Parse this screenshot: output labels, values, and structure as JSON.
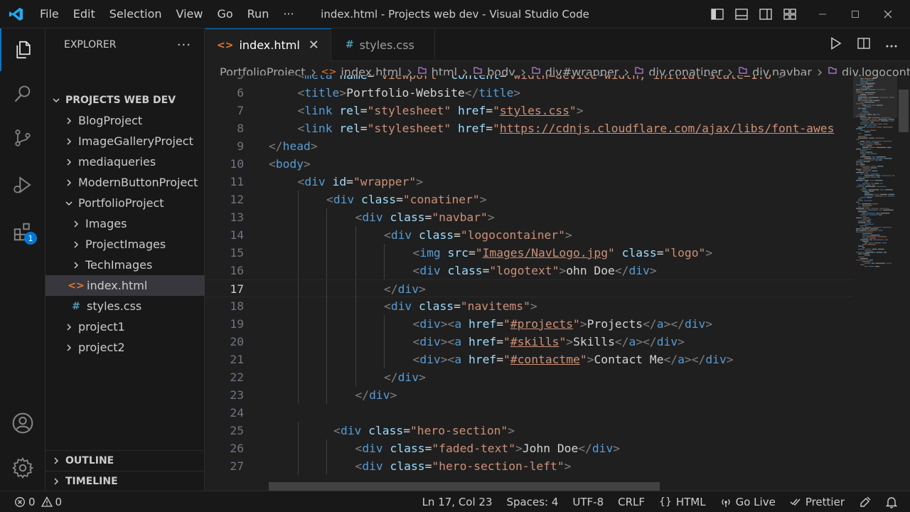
{
  "titlebar": {
    "menu": [
      "File",
      "Edit",
      "Selection",
      "View",
      "Go",
      "Run",
      "···"
    ],
    "title": "index.html - Projects web dev - Visual Studio Code"
  },
  "activitybar": {
    "extensions_badge": "1"
  },
  "sidebar": {
    "title": "EXPLORER",
    "more": "···",
    "root": "PROJECTS WEB DEV",
    "items": [
      {
        "label": "BlogProject",
        "kind": "folder",
        "expanded": false,
        "depth": 1
      },
      {
        "label": "ImageGalleryProject",
        "kind": "folder",
        "expanded": false,
        "depth": 1
      },
      {
        "label": "mediaqueries",
        "kind": "folder",
        "expanded": false,
        "depth": 1
      },
      {
        "label": "ModernButtonProject",
        "kind": "folder",
        "expanded": false,
        "depth": 1
      },
      {
        "label": "PortfolioProject",
        "kind": "folder",
        "expanded": true,
        "depth": 1
      },
      {
        "label": "Images",
        "kind": "folder",
        "expanded": false,
        "depth": 2
      },
      {
        "label": "ProjectImages",
        "kind": "folder",
        "expanded": false,
        "depth": 2
      },
      {
        "label": "TechImages",
        "kind": "folder",
        "expanded": false,
        "depth": 2
      },
      {
        "label": "index.html",
        "kind": "html",
        "depth": 2,
        "selected": true
      },
      {
        "label": "styles.css",
        "kind": "css",
        "depth": 2
      },
      {
        "label": "project1",
        "kind": "folder",
        "expanded": false,
        "depth": 1
      },
      {
        "label": "project2",
        "kind": "folder",
        "expanded": false,
        "depth": 1
      }
    ],
    "outline": "OUTLINE",
    "timeline": "TIMELINE"
  },
  "tabs": [
    {
      "label": "index.html",
      "icon": "<>",
      "active": true,
      "close": "✕"
    },
    {
      "label": "styles.css",
      "icon": "#",
      "active": false
    }
  ],
  "breadcrumb": [
    "PortfolioProject",
    "index.html",
    "html",
    "body",
    "div#wrapper",
    "div.conatiner",
    "div.navbar",
    "div.logocontai"
  ],
  "editor": {
    "current_line": 17,
    "lines": [
      {
        "n": 5,
        "indent": 1,
        "tokens": [
          [
            "t-br",
            "<"
          ],
          [
            "t-tag",
            "meta"
          ],
          [
            "t-text",
            " "
          ],
          [
            "t-attr",
            "name"
          ],
          [
            "t-text",
            "="
          ],
          [
            "t-str",
            "\"viewport\""
          ],
          [
            "t-text",
            " "
          ],
          [
            "t-attr",
            "content"
          ],
          [
            "t-text",
            "="
          ],
          [
            "t-str",
            "\"width=device-width, initial-scale=1.0\""
          ],
          [
            "t-br",
            ">"
          ]
        ]
      },
      {
        "n": 6,
        "indent": 1,
        "tokens": [
          [
            "t-br",
            "<"
          ],
          [
            "t-tag",
            "title"
          ],
          [
            "t-br",
            ">"
          ],
          [
            "t-text",
            "Portfolio-Website"
          ],
          [
            "t-br",
            "</"
          ],
          [
            "t-tag",
            "title"
          ],
          [
            "t-br",
            ">"
          ]
        ]
      },
      {
        "n": 7,
        "indent": 1,
        "tokens": [
          [
            "t-br",
            "<"
          ],
          [
            "t-tag",
            "link"
          ],
          [
            "t-text",
            " "
          ],
          [
            "t-attr",
            "rel"
          ],
          [
            "t-text",
            "="
          ],
          [
            "t-str",
            "\"stylesheet\""
          ],
          [
            "t-text",
            " "
          ],
          [
            "t-attr",
            "href"
          ],
          [
            "t-text",
            "="
          ],
          [
            "t-str",
            "\""
          ],
          [
            "t-link",
            "styles.css"
          ],
          [
            "t-str",
            "\""
          ],
          [
            "t-br",
            ">"
          ]
        ]
      },
      {
        "n": 8,
        "indent": 1,
        "tokens": [
          [
            "t-br",
            "<"
          ],
          [
            "t-tag",
            "link"
          ],
          [
            "t-text",
            " "
          ],
          [
            "t-attr",
            "rel"
          ],
          [
            "t-text",
            "="
          ],
          [
            "t-str",
            "\"stylesheet\""
          ],
          [
            "t-text",
            " "
          ],
          [
            "t-attr",
            "href"
          ],
          [
            "t-text",
            "="
          ],
          [
            "t-str",
            "\""
          ],
          [
            "t-link",
            "https://cdnjs.cloudflare.com/ajax/libs/font-awes"
          ]
        ]
      },
      {
        "n": 9,
        "indent": 0,
        "tokens": [
          [
            "t-br",
            "</"
          ],
          [
            "t-tag",
            "head"
          ],
          [
            "t-br",
            ">"
          ]
        ]
      },
      {
        "n": 10,
        "indent": 0,
        "tokens": [
          [
            "t-br",
            "<"
          ],
          [
            "t-tag",
            "body"
          ],
          [
            "t-br",
            ">"
          ]
        ]
      },
      {
        "n": 11,
        "indent": 1,
        "tokens": [
          [
            "t-br",
            "<"
          ],
          [
            "t-tag",
            "div"
          ],
          [
            "t-text",
            " "
          ],
          [
            "t-attr",
            "id"
          ],
          [
            "t-text",
            "="
          ],
          [
            "t-str",
            "\"wrapper\""
          ],
          [
            "t-br",
            ">"
          ]
        ]
      },
      {
        "n": 12,
        "indent": 2,
        "tokens": [
          [
            "t-br",
            "<"
          ],
          [
            "t-tag",
            "div"
          ],
          [
            "t-text",
            " "
          ],
          [
            "t-attr",
            "class"
          ],
          [
            "t-text",
            "="
          ],
          [
            "t-str",
            "\"conatiner\""
          ],
          [
            "t-br",
            ">"
          ]
        ]
      },
      {
        "n": 13,
        "indent": 3,
        "tokens": [
          [
            "t-br",
            "<"
          ],
          [
            "t-tag",
            "div"
          ],
          [
            "t-text",
            " "
          ],
          [
            "t-attr",
            "class"
          ],
          [
            "t-text",
            "="
          ],
          [
            "t-str",
            "\"navbar\""
          ],
          [
            "t-br",
            ">"
          ]
        ]
      },
      {
        "n": 14,
        "indent": 4,
        "tokens": [
          [
            "t-br",
            "<"
          ],
          [
            "t-tag",
            "div"
          ],
          [
            "t-text",
            " "
          ],
          [
            "t-attr",
            "class"
          ],
          [
            "t-text",
            "="
          ],
          [
            "t-str",
            "\"logocontainer\""
          ],
          [
            "t-br",
            ">"
          ]
        ]
      },
      {
        "n": 15,
        "indent": 5,
        "tokens": [
          [
            "t-br",
            "<"
          ],
          [
            "t-tag",
            "img"
          ],
          [
            "t-text",
            " "
          ],
          [
            "t-attr",
            "src"
          ],
          [
            "t-text",
            "="
          ],
          [
            "t-str",
            "\""
          ],
          [
            "t-link",
            "Images/NavLogo.jpg"
          ],
          [
            "t-str",
            "\""
          ],
          [
            "t-text",
            " "
          ],
          [
            "t-attr",
            "class"
          ],
          [
            "t-text",
            "="
          ],
          [
            "t-str",
            "\"logo\""
          ],
          [
            "t-br",
            ">"
          ]
        ]
      },
      {
        "n": 16,
        "indent": 5,
        "tokens": [
          [
            "t-br",
            "<"
          ],
          [
            "t-tag",
            "div"
          ],
          [
            "t-text",
            " "
          ],
          [
            "t-attr",
            "class"
          ],
          [
            "t-text",
            "="
          ],
          [
            "t-str",
            "\"logotext\""
          ],
          [
            "t-br",
            ">"
          ],
          [
            "t-text",
            "ohn Doe"
          ],
          [
            "t-br",
            "</"
          ],
          [
            "t-tag",
            "div"
          ],
          [
            "t-br",
            ">"
          ]
        ]
      },
      {
        "n": 17,
        "indent": 4,
        "tokens": [
          [
            "t-br",
            "</"
          ],
          [
            "t-tag",
            "div"
          ],
          [
            "t-br",
            ">"
          ]
        ]
      },
      {
        "n": 18,
        "indent": 4,
        "tokens": [
          [
            "t-br",
            "<"
          ],
          [
            "t-tag",
            "div"
          ],
          [
            "t-text",
            " "
          ],
          [
            "t-attr",
            "class"
          ],
          [
            "t-text",
            "="
          ],
          [
            "t-str",
            "\"navitems\""
          ],
          [
            "t-br",
            ">"
          ]
        ]
      },
      {
        "n": 19,
        "indent": 5,
        "tokens": [
          [
            "t-br",
            "<"
          ],
          [
            "t-tag",
            "div"
          ],
          [
            "t-br",
            "><"
          ],
          [
            "t-tag",
            "a"
          ],
          [
            "t-text",
            " "
          ],
          [
            "t-attr",
            "href"
          ],
          [
            "t-text",
            "="
          ],
          [
            "t-str",
            "\""
          ],
          [
            "t-link",
            "#projects"
          ],
          [
            "t-str",
            "\""
          ],
          [
            "t-br",
            ">"
          ],
          [
            "t-text",
            "Projects"
          ],
          [
            "t-br",
            "</"
          ],
          [
            "t-tag",
            "a"
          ],
          [
            "t-br",
            "></"
          ],
          [
            "t-tag",
            "div"
          ],
          [
            "t-br",
            ">"
          ]
        ]
      },
      {
        "n": 20,
        "indent": 5,
        "tokens": [
          [
            "t-br",
            "<"
          ],
          [
            "t-tag",
            "div"
          ],
          [
            "t-br",
            "><"
          ],
          [
            "t-tag",
            "a"
          ],
          [
            "t-text",
            " "
          ],
          [
            "t-attr",
            "href"
          ],
          [
            "t-text",
            "="
          ],
          [
            "t-str",
            "\""
          ],
          [
            "t-link",
            "#skills"
          ],
          [
            "t-str",
            "\""
          ],
          [
            "t-br",
            ">"
          ],
          [
            "t-text",
            "Skills"
          ],
          [
            "t-br",
            "</"
          ],
          [
            "t-tag",
            "a"
          ],
          [
            "t-br",
            "></"
          ],
          [
            "t-tag",
            "div"
          ],
          [
            "t-br",
            ">"
          ]
        ]
      },
      {
        "n": 21,
        "indent": 5,
        "tokens": [
          [
            "t-br",
            "<"
          ],
          [
            "t-tag",
            "div"
          ],
          [
            "t-br",
            "><"
          ],
          [
            "t-tag",
            "a"
          ],
          [
            "t-text",
            " "
          ],
          [
            "t-attr",
            "href"
          ],
          [
            "t-text",
            "="
          ],
          [
            "t-str",
            "\""
          ],
          [
            "t-link",
            "#contactme"
          ],
          [
            "t-str",
            "\""
          ],
          [
            "t-br",
            ">"
          ],
          [
            "t-text",
            "Contact Me"
          ],
          [
            "t-br",
            "</"
          ],
          [
            "t-tag",
            "a"
          ],
          [
            "t-br",
            "></"
          ],
          [
            "t-tag",
            "div"
          ],
          [
            "t-br",
            ">"
          ]
        ]
      },
      {
        "n": 22,
        "indent": 4,
        "tokens": [
          [
            "t-br",
            "</"
          ],
          [
            "t-tag",
            "div"
          ],
          [
            "t-br",
            ">"
          ]
        ]
      },
      {
        "n": 23,
        "indent": 3,
        "tokens": [
          [
            "t-br",
            "</"
          ],
          [
            "t-tag",
            "div"
          ],
          [
            "t-br",
            ">"
          ]
        ]
      },
      {
        "n": 24,
        "indent": 0,
        "tokens": []
      },
      {
        "n": 25,
        "indent": 2.25,
        "tokens": [
          [
            "t-br",
            "<"
          ],
          [
            "t-tag",
            "div"
          ],
          [
            "t-text",
            " "
          ],
          [
            "t-attr",
            "class"
          ],
          [
            "t-text",
            "="
          ],
          [
            "t-str",
            "\"hero-section\""
          ],
          [
            "t-br",
            ">"
          ]
        ]
      },
      {
        "n": 26,
        "indent": 3,
        "tokens": [
          [
            "t-br",
            "<"
          ],
          [
            "t-tag",
            "div"
          ],
          [
            "t-text",
            " "
          ],
          [
            "t-attr",
            "class"
          ],
          [
            "t-text",
            "="
          ],
          [
            "t-str",
            "\"faded-text\""
          ],
          [
            "t-br",
            ">"
          ],
          [
            "t-text",
            "John Doe"
          ],
          [
            "t-br",
            "</"
          ],
          [
            "t-tag",
            "div"
          ],
          [
            "t-br",
            ">"
          ]
        ]
      },
      {
        "n": 27,
        "indent": 3,
        "tokens": [
          [
            "t-br",
            "<"
          ],
          [
            "t-tag",
            "div"
          ],
          [
            "t-text",
            " "
          ],
          [
            "t-attr",
            "class"
          ],
          [
            "t-text",
            "="
          ],
          [
            "t-str",
            "\"hero-section-left\""
          ],
          [
            "t-br",
            ">"
          ]
        ]
      }
    ]
  },
  "statusbar": {
    "errors": "0",
    "warnings": "0",
    "position": "Ln 17, Col 23",
    "spaces": "Spaces: 4",
    "encoding": "UTF-8",
    "eol": "CRLF",
    "language": "HTML",
    "golive": "Go Live",
    "prettier": "Prettier"
  },
  "colors": {
    "accent": "#0078d4",
    "html_icon": "#e37933",
    "css_icon": "#519aba",
    "folder_chevron": "#cccccc"
  }
}
